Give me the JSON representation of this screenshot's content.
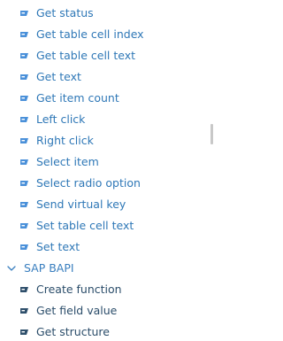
{
  "list": {
    "items": [
      {
        "label": "Get status",
        "icon": "sap-action-icon"
      },
      {
        "label": "Get table cell index",
        "icon": "sap-action-icon"
      },
      {
        "label": "Get table cell text",
        "icon": "sap-action-icon"
      },
      {
        "label": "Get text",
        "icon": "sap-action-icon"
      },
      {
        "label": "Get item count",
        "icon": "sap-action-icon"
      },
      {
        "label": "Left click",
        "icon": "sap-action-icon"
      },
      {
        "label": "Right click",
        "icon": "sap-action-icon"
      },
      {
        "label": "Select item",
        "icon": "sap-action-icon"
      },
      {
        "label": "Select radio option",
        "icon": "sap-action-icon"
      },
      {
        "label": "Send virtual key",
        "icon": "sap-action-icon"
      },
      {
        "label": "Set table cell text",
        "icon": "sap-action-icon"
      },
      {
        "label": "Set text",
        "icon": "sap-action-icon"
      }
    ]
  },
  "group": {
    "label": "SAP BAPI",
    "expanded": true,
    "icon": "chevron-down-icon",
    "items": [
      {
        "label": "Create function",
        "icon": "sap-action-icon"
      },
      {
        "label": "Get field value",
        "icon": "sap-action-icon"
      },
      {
        "label": "Get structure",
        "icon": "sap-action-icon"
      }
    ]
  },
  "colors": {
    "item_text": "#2f78b7",
    "group_item_text": "#2b4d6a",
    "group_header": "#3a7fbf",
    "icon_blue": "#4a90d9",
    "icon_dark": "#2e4f6b"
  }
}
